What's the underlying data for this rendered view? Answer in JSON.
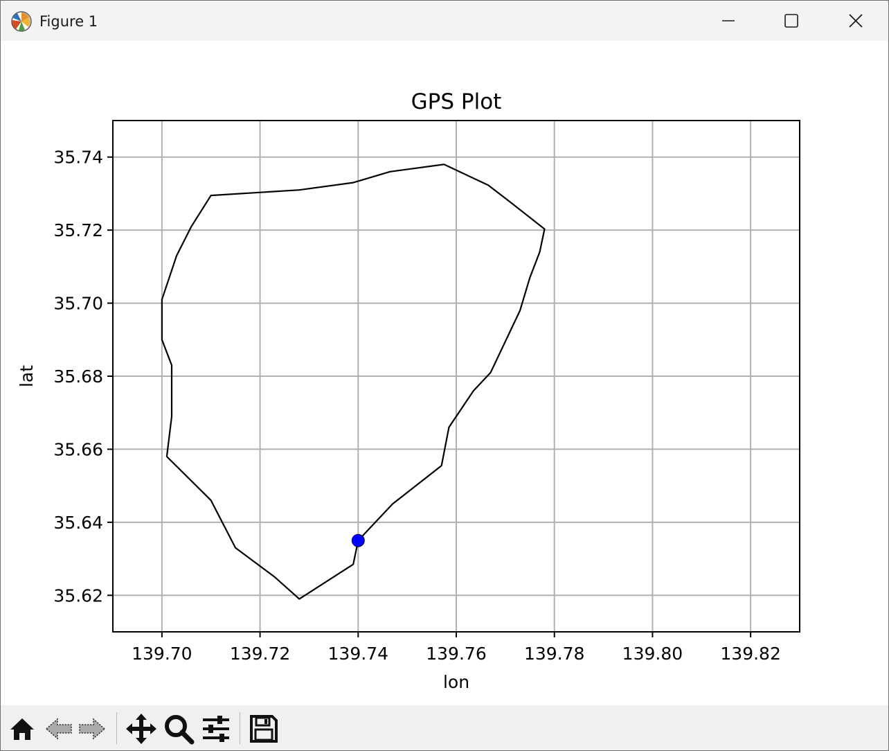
{
  "window": {
    "title": "Figure 1",
    "icon": "matplotlib-icon",
    "controls": [
      "minimize-icon",
      "maximize-icon",
      "close-icon"
    ]
  },
  "toolbar": {
    "buttons": [
      "home-icon",
      "back-arrow-icon",
      "forward-arrow-icon",
      "pan-icon",
      "zoom-icon",
      "configure-subplots-icon",
      "save-icon"
    ]
  },
  "chart_data": {
    "type": "line",
    "title": "GPS Plot",
    "xlabel": "lon",
    "ylabel": "lat",
    "xlim": [
      139.69,
      139.83
    ],
    "ylim": [
      35.61,
      35.75
    ],
    "grid": true,
    "xticks": [
      "139.70",
      "139.72",
      "139.74",
      "139.76",
      "139.78",
      "139.80",
      "139.82"
    ],
    "yticks": [
      "35.62",
      "35.64",
      "35.66",
      "35.68",
      "35.70",
      "35.72",
      "35.74"
    ],
    "xtick_values": [
      139.7,
      139.72,
      139.74,
      139.76,
      139.78,
      139.8,
      139.82
    ],
    "ytick_values": [
      35.62,
      35.64,
      35.66,
      35.68,
      35.7,
      35.72,
      35.74
    ],
    "line_color": "#000000",
    "series": [
      {
        "x": [
          139.74,
          139.747,
          139.757,
          139.7585,
          139.7635,
          139.767,
          139.773,
          139.775,
          139.777,
          139.778,
          139.771,
          139.7665,
          139.7575,
          139.7465,
          139.739,
          139.728,
          139.71,
          139.706,
          139.703,
          139.7,
          139.7,
          139.702,
          139.702,
          139.701,
          139.71,
          139.715,
          139.723,
          139.728,
          139.739,
          139.74
        ],
        "y": [
          35.635,
          35.645,
          35.6555,
          35.666,
          35.676,
          35.681,
          35.698,
          35.707,
          35.714,
          35.7203,
          35.7277,
          35.7323,
          35.738,
          35.736,
          35.733,
          35.731,
          35.7295,
          35.721,
          35.713,
          35.701,
          35.69,
          35.683,
          35.669,
          35.658,
          35.646,
          35.633,
          35.625,
          35.619,
          35.6285,
          35.635
        ]
      }
    ],
    "marker": {
      "x": 139.74,
      "y": 35.635,
      "color": "#0000ff"
    }
  }
}
